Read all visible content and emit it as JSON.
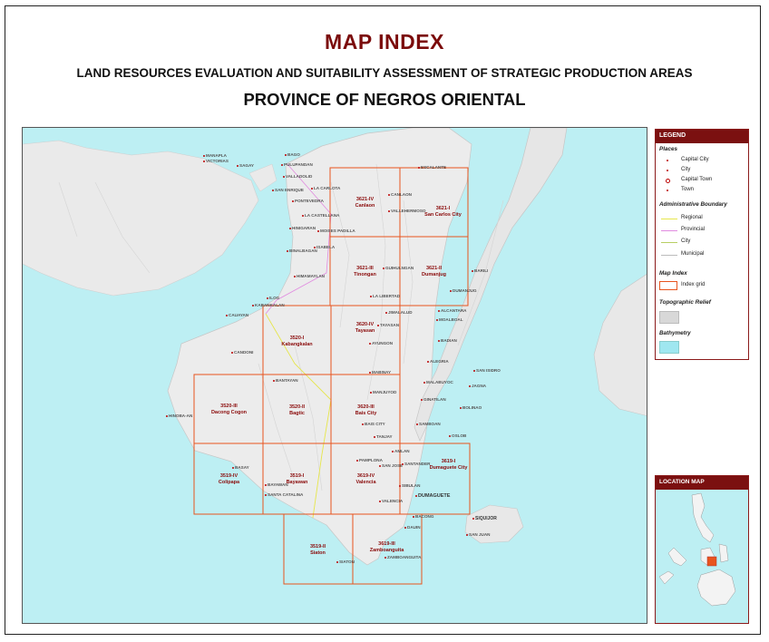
{
  "header": {
    "title": "MAP INDEX",
    "subtitle": "LAND RESOURCES EVALUATION AND SUITABILITY ASSESSMENT OF STRATEGIC PRODUCTION AREAS",
    "province": "PROVINCE OF NEGROS ORIENTAL"
  },
  "colors": {
    "title": "#7b0b0b",
    "index_grid": "#e8541e",
    "sea": "#bdeff3",
    "land": "#ececec",
    "legend_header": "#7b1010"
  },
  "map": {
    "index_sheets": [
      {
        "id": "3621-IV",
        "name": "Canlaon"
      },
      {
        "id": "3621-I",
        "name": "San Carlos City"
      },
      {
        "id": "3621-III",
        "name": "Tinongan"
      },
      {
        "id": "3621-II",
        "name": "Dumanjug"
      },
      {
        "id": "3520-I",
        "name": "Kabangkalan"
      },
      {
        "id": "3620-IV",
        "name": "Tayasan"
      },
      {
        "id": "3520-III",
        "name": "Dacong Cogon"
      },
      {
        "id": "3520-II",
        "name": "Bagtic"
      },
      {
        "id": "3620-III",
        "name": "Bais City"
      },
      {
        "id": "3519-IV",
        "name": "Colipapa"
      },
      {
        "id": "3519-I",
        "name": "Bayawan"
      },
      {
        "id": "3619-IV",
        "name": "Valencia"
      },
      {
        "id": "3619-I",
        "name": "Dumaguete City"
      },
      {
        "id": "3519-II",
        "name": "Siaton"
      },
      {
        "id": "3619-III",
        "name": "Zamboanguita"
      }
    ],
    "places": {
      "manapla": "MANAPLA",
      "victorias": "VICTORIAS",
      "sagay": "SAGAY",
      "escalante": "ESCALANTE",
      "bago": "BAGO",
      "pulupandan": "PULUPANDAN",
      "valladolid": "VALLADOLID",
      "san_enrique": "SAN ENRIQUE",
      "pontevedra": "PONTEVEDRA",
      "la_carlota": "LA CARLOTA",
      "la_castellana": "LA CASTELLANA",
      "hinigaran": "HINIGARAN",
      "moises_padilla": "MOISES PADILLA",
      "binalbagan": "BINALBAGAN",
      "isabela": "ISABELA",
      "himamaylan": "HIMAMAYLAN",
      "ilog": "ILOG",
      "kabankalan": "KABANKALAN",
      "cauayan": "CAUAYAN",
      "candoni": "CANDONI",
      "hinoba_an": "HINOBA-AN",
      "canlaon": "CANLAON",
      "vallehermoso": "VALLEHERMOSO",
      "san_carlos": "SAN CARLOS",
      "guihulngan": "GUIHULNGAN",
      "la_libertad": "LA LIBERTAD",
      "jimalalud": "JIMALALUD",
      "tayasan": "TAYASAN",
      "ayungon": "AYUNGON",
      "mabinay": "MABINAY",
      "manjuyod": "MANJUYOD",
      "bais_city": "BAIS CITY",
      "tanjay": "TANJAY",
      "pamplona": "PAMPLONA",
      "san_jose": "SAN JOSE",
      "amlan": "AMLAN",
      "sibulan": "SIBULAN",
      "dumaguete": "DUMAGUETE",
      "valencia": "VALENCIA",
      "bacong": "BACONG",
      "dauin": "DAUIN",
      "zamboanguita": "ZAMBOANGUITA",
      "siaton": "SIATON",
      "santa_catalina": "SANTA CATALINA",
      "basay": "BASAY",
      "bayawan": "BAYAWAN",
      "bantayan": "BANTAYAN",
      "siquijor": "SIQUIJOR",
      "san_juan": "SAN JUAN",
      "barili": "BARILI",
      "dumanjug": "DUMANJUG",
      "alcantara": "ALCANTARA",
      "moalboal": "MOALBOAL",
      "badian": "BADIAN",
      "alegria": "ALEGRIA",
      "san_isidro": "SAN ISIDRO",
      "malabuyoc": "MALABUYOC",
      "jagna": "JAGNA",
      "ginatilan": "GINATILAN",
      "samboan": "SAMBOAN",
      "bolinao": "BOLINAO",
      "oslob": "OSLOB",
      "santander": "SANTANDER"
    }
  },
  "legend": {
    "title": "LEGEND",
    "places_heading": "Places",
    "places": [
      "Capital City",
      "City",
      "Capital Town",
      "Town"
    ],
    "admin_heading": "Administrative Boundary",
    "admin": [
      "Regional",
      "Provincial",
      "City",
      "Municipal"
    ],
    "admin_colors": [
      "#e6e64c",
      "#e18be0",
      "#b7cf62",
      "#bbbbbb"
    ],
    "mapindex_heading": "Map Index",
    "mapindex_item": "Index grid",
    "relief_heading": "Topographic Relief",
    "bathymetry_heading": "Bathymetry"
  },
  "location_map": {
    "title": "LOCATION MAP"
  }
}
